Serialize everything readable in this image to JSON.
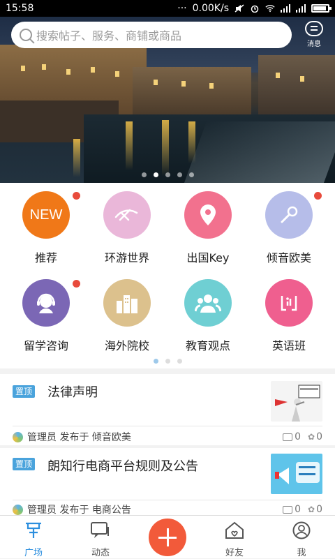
{
  "statusbar": {
    "time": "15:58",
    "speed": "0.00K/s"
  },
  "search": {
    "placeholder": "搜索帖子、服务、商铺或商品"
  },
  "message": {
    "label": "消息"
  },
  "banner": {
    "active_dot": 2,
    "dot_count": 5
  },
  "categories": [
    {
      "label": "推荐",
      "icon": "new-icon",
      "icon_text": "NEW",
      "color": "#f07818",
      "badge": true
    },
    {
      "label": "环游世界",
      "icon": "plane-icon",
      "color": "#eab7d9",
      "badge": false
    },
    {
      "label": "出国Key",
      "icon": "location-pin-icon",
      "color": "#f2718e",
      "badge": false
    },
    {
      "label": "倾音欧美",
      "icon": "microphone-icon",
      "color": "#b6bde9",
      "badge": true
    },
    {
      "label": "留学咨询",
      "icon": "headset-person-icon",
      "color": "#7b67b5",
      "badge": true
    },
    {
      "label": "海外院校",
      "icon": "buildings-icon",
      "color": "#dcc18d",
      "badge": false
    },
    {
      "label": "教育观点",
      "icon": "people-icon",
      "color": "#6fcfd3",
      "badge": false
    },
    {
      "label": "英语班",
      "icon": "english-class-icon",
      "color": "#ef5f8f",
      "badge": false
    }
  ],
  "category_pages": {
    "count": 3,
    "active": 1
  },
  "posts": [
    {
      "tag": "置顶",
      "title": "法律声明",
      "author": "管理员",
      "published_in": "发布于 倾音欧美",
      "comments": "0",
      "likes": "0"
    },
    {
      "tag": "置顶",
      "title": "朗知行电商平台规则及公告",
      "author": "管理员",
      "published_in": "发布于 电商公告",
      "comments": "0",
      "likes": "0"
    }
  ],
  "tabs": [
    {
      "label": "广场",
      "icon": "square-icon",
      "active": true
    },
    {
      "label": "动态",
      "icon": "chat-icon",
      "active": false
    },
    {
      "label": "",
      "icon": "plus-icon",
      "active": false
    },
    {
      "label": "好友",
      "icon": "friends-home-icon",
      "active": false
    },
    {
      "label": "我",
      "icon": "profile-icon",
      "active": false
    }
  ],
  "colors": {
    "accent": "#2b8ede",
    "tag": "#4aa3dc",
    "fab": "#f25a3a",
    "badge": "#e84b3c"
  }
}
